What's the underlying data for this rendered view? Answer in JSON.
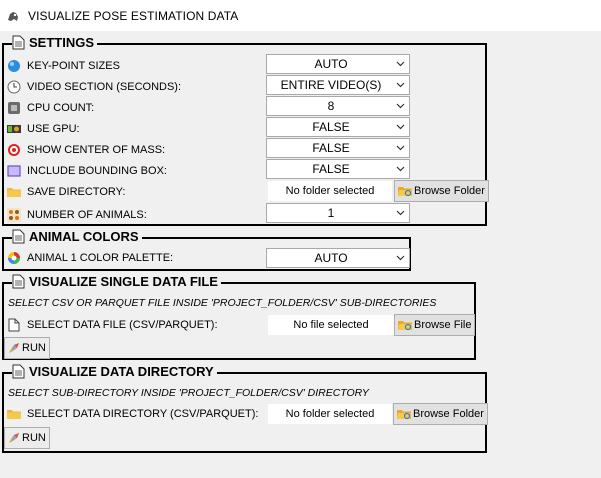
{
  "window": {
    "title": "VISUALIZE POSE ESTIMATION DATA"
  },
  "settings": {
    "title": "SETTINGS",
    "keypoint_sizes": {
      "label": "KEY-POINT SIZES",
      "value": "AUTO",
      "icon": "keypoint-icon"
    },
    "video_section": {
      "label": "VIDEO SECTION (SECONDS):",
      "value": "ENTIRE VIDEO(S)",
      "icon": "clock-icon"
    },
    "cpu_count": {
      "label": "CPU COUNT:",
      "value": "8",
      "icon": "cpu-icon"
    },
    "use_gpu": {
      "label": "USE GPU:",
      "value": "FALSE",
      "icon": "gpu-icon"
    },
    "center_of_mass": {
      "label": "SHOW CENTER OF MASS:",
      "value": "FALSE",
      "icon": "target-icon"
    },
    "bounding_box": {
      "label": "INCLUDE BOUNDING BOX:",
      "value": "FALSE",
      "icon": "bounding-box-icon"
    },
    "save_directory": {
      "label": "SAVE DIRECTORY:",
      "value": "No folder selected",
      "button": "Browse Folder",
      "icon": "folder-icon"
    },
    "number_of_animals": {
      "label": "NUMBER OF ANIMALS:",
      "value": "1",
      "icon": "animals-icon"
    }
  },
  "animal_colors": {
    "title": "ANIMAL COLORS",
    "palette": {
      "label": "ANIMAL 1 COLOR PALETTE:",
      "value": "AUTO",
      "icon": "palette-icon"
    }
  },
  "single_file": {
    "title": "VISUALIZE SINGLE DATA FILE",
    "note": "SELECT CSV OR PARQUET FILE INSIDE 'PROJECT_FOLDER/CSV' SUB-DIRECTORIES",
    "select_label": "SELECT DATA FILE (CSV/PARQUET):",
    "value": "No file selected",
    "button": "Browse File",
    "run": "RUN"
  },
  "directory": {
    "title": "VISUALIZE DATA DIRECTORY",
    "note": "SELECT SUB-DIRECTORY INSIDE 'PROJECT_FOLDER/CSV' DIRECTORY",
    "select_label": "SELECT DATA DIRECTORY (CSV/PARQUET):",
    "value": "No folder selected",
    "button": "Browse Folder",
    "run": "RUN"
  }
}
